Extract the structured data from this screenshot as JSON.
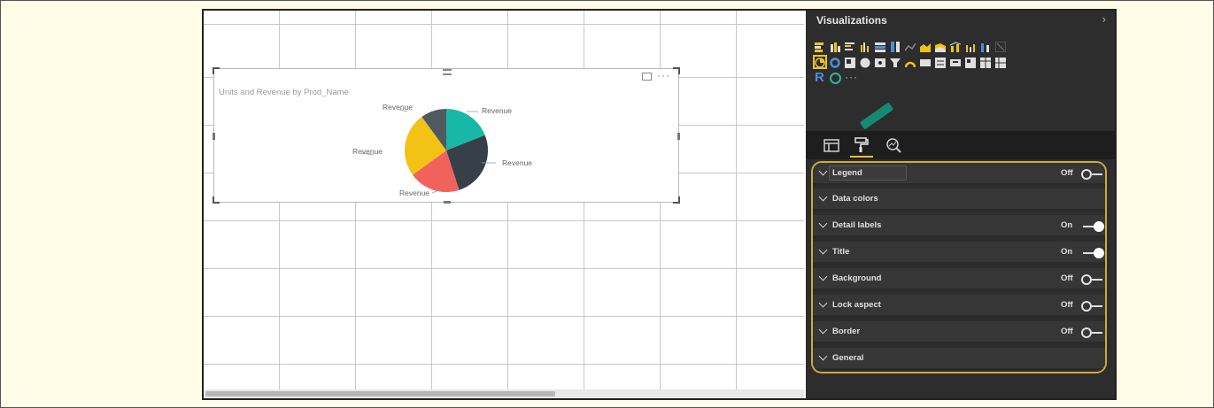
{
  "canvas": {
    "visual": {
      "title": "Units and Revenue by Prod_Name",
      "more_label": "···",
      "pie_labels": [
        "Revenue",
        "Revenue",
        "Revenue",
        "Revenue",
        "Revenue"
      ]
    },
    "chart_data": {
      "type": "pie",
      "title": "Units and Revenue by Prod_Name",
      "slices": [
        {
          "label": "Revenue",
          "value": 19,
          "color": "#18b8a6"
        },
        {
          "label": "Revenue",
          "value": 26,
          "color": "#374048"
        },
        {
          "label": "Revenue",
          "value": 20,
          "color": "#f0625b"
        },
        {
          "label": "Revenue",
          "value": 25,
          "color": "#f2c314"
        },
        {
          "label": "Revenue",
          "value": 10,
          "color": "#4f5a60"
        }
      ]
    }
  },
  "pane": {
    "title": "Visualizations",
    "chevron": "›",
    "r_label": "R",
    "more_visuals": "···",
    "tabs": [
      {
        "name": "fields"
      },
      {
        "name": "format"
      },
      {
        "name": "analytics"
      }
    ],
    "properties": [
      {
        "label": "Legend",
        "state": "Off",
        "toggle": "off"
      },
      {
        "label": "Data colors",
        "state": "",
        "toggle": "none"
      },
      {
        "label": "Detail labels",
        "state": "On",
        "toggle": "on"
      },
      {
        "label": "Title",
        "state": "On",
        "toggle": "on"
      },
      {
        "label": "Background",
        "state": "Off",
        "toggle": "off"
      },
      {
        "label": "Lock aspect",
        "state": "Off",
        "toggle": "off"
      },
      {
        "label": "Border",
        "state": "Off",
        "toggle": "off"
      },
      {
        "label": "General",
        "state": "",
        "toggle": "none"
      }
    ]
  },
  "colors": {
    "accent": "#e8c230",
    "pane_bg": "#2d2d2d",
    "page_bg": "#fffde8"
  }
}
